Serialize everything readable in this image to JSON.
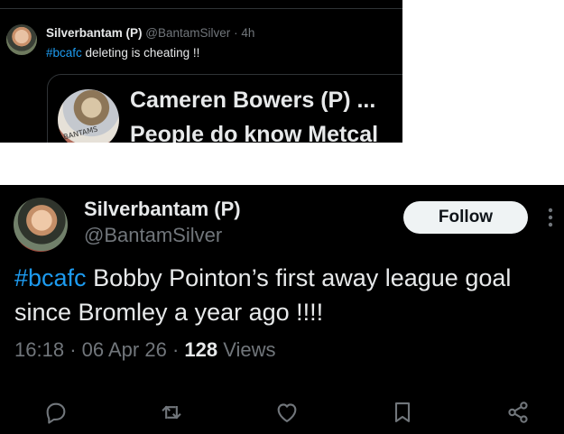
{
  "top_tweet": {
    "author_name": "Silverbantam (P)",
    "handle": "@BantamSilver",
    "separator": "·",
    "time": "4h",
    "hashtag": "#bcafc",
    "text": " deleting is cheating !!",
    "quote": {
      "author_name": "Cameren Bowers (P) ...",
      "text": "People do know Metcal",
      "avatar_sign_text": "BANTAMS"
    }
  },
  "main_tweet": {
    "author_name": "Silverbantam (P)",
    "handle": "@BantamSilver",
    "follow_label": "Follow",
    "hashtag": "#bcafc",
    "text_line1": " Bobby Pointon’s first away league goal",
    "text_line2": "since Bromley a year ago !!!!",
    "time": "16:18",
    "date": "06 Apr 26",
    "views_count": "128",
    "views_label": " Views",
    "separator": "·"
  },
  "actions": {
    "icons": [
      "reply-icon",
      "retweet-icon",
      "like-icon",
      "bookmark-icon",
      "share-icon"
    ]
  },
  "colors": {
    "background": "#000000",
    "text": "#e7e9ea",
    "muted": "#71767b",
    "link": "#1d9bf0",
    "follow_bg": "#eff3f4"
  }
}
